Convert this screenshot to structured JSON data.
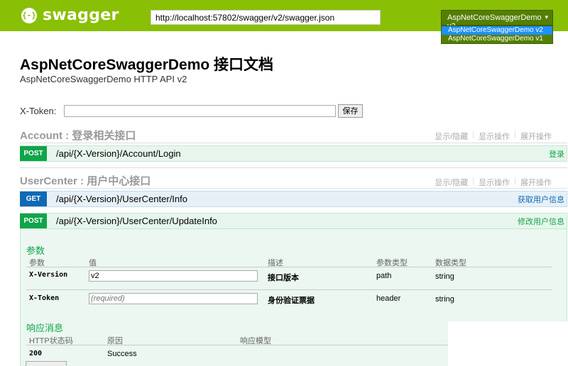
{
  "header": {
    "logo_text": "swagger",
    "logo_glyph": "{-}",
    "url": "http://localhost:57802/swagger/v2/swagger.json",
    "selected_spec": "AspNetCoreSwaggerDemo v2",
    "caret": "▾",
    "spec_options": [
      "AspNetCoreSwaggerDemo v2",
      "AspNetCoreSwaggerDemo v1"
    ]
  },
  "info": {
    "title": "AspNetCoreSwaggerDemo 接口文档",
    "subtitle": "AspNetCoreSwaggerDemo HTTP API v2"
  },
  "token": {
    "label": "X-Token:",
    "value": "",
    "save_label": "保存"
  },
  "sections": [
    {
      "title": "Account : 登录相关接口",
      "actions": [
        "显示/隐藏",
        "显示操作",
        "展开操作"
      ],
      "operations": [
        {
          "method": "POST",
          "path": "/api/{X-Version}/Account/Login",
          "summary": "登录"
        }
      ]
    },
    {
      "title": "UserCenter : 用户中心接口",
      "actions": [
        "显示/隐藏",
        "显示操作",
        "展开操作"
      ],
      "operations": [
        {
          "method": "GET",
          "path": "/api/{X-Version}/UserCenter/Info",
          "summary": "获取用户信息"
        },
        {
          "method": "POST",
          "path": "/api/{X-Version}/UserCenter/UpdateInfo",
          "summary": "修改用户信息"
        }
      ]
    }
  ],
  "parameters": {
    "heading": "参数",
    "columns": [
      "参数",
      "值",
      "描述",
      "参数类型",
      "数据类型"
    ],
    "rows": [
      {
        "name": "X-Version",
        "value": "v2",
        "placeholder": "",
        "description": "接口版本",
        "param_type": "path",
        "data_type": "string"
      },
      {
        "name": "X-Token",
        "value": "",
        "placeholder": "(required)",
        "description": "身份验证票据",
        "param_type": "header",
        "data_type": "string"
      }
    ]
  },
  "responses": {
    "heading": "响应消息",
    "columns": [
      "HTTP状态码",
      "原因",
      "响应模型"
    ],
    "rows": [
      {
        "code": "200",
        "reason": "Success"
      }
    ]
  },
  "colors": {
    "brand": "#89bf04",
    "post": "#10a54a",
    "get": "#0f6ab4"
  }
}
